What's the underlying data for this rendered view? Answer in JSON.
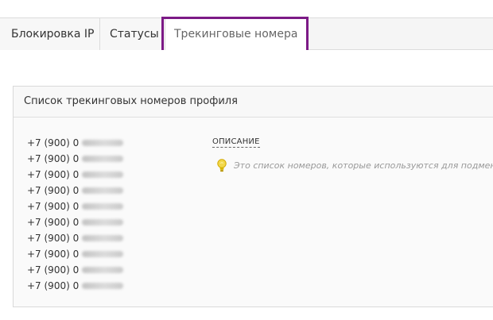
{
  "tabs": {
    "ip_block": "Блокировка IP",
    "statuses": "Статусы",
    "tracking_numbers": "Трекинговые номера"
  },
  "panel": {
    "title": "Список трекинговых номеров профиля",
    "description_label": "ОПИСАНИЕ",
    "hint_text": "Это список номеров, которые используются для подмен",
    "hint_icon": "lightbulb-icon",
    "highlight_color": "#7c1a86"
  },
  "phones": [
    {
      "prefix": "+7 (900) 0"
    },
    {
      "prefix": "+7 (900) 0"
    },
    {
      "prefix": "+7 (900) 0"
    },
    {
      "prefix": "+7 (900) 0"
    },
    {
      "prefix": "+7 (900) 0"
    },
    {
      "prefix": "+7 (900) 0"
    },
    {
      "prefix": "+7 (900) 0"
    },
    {
      "prefix": "+7 (900) 0"
    },
    {
      "prefix": "+7 (900) 0"
    },
    {
      "prefix": "+7 (900) 0"
    }
  ]
}
